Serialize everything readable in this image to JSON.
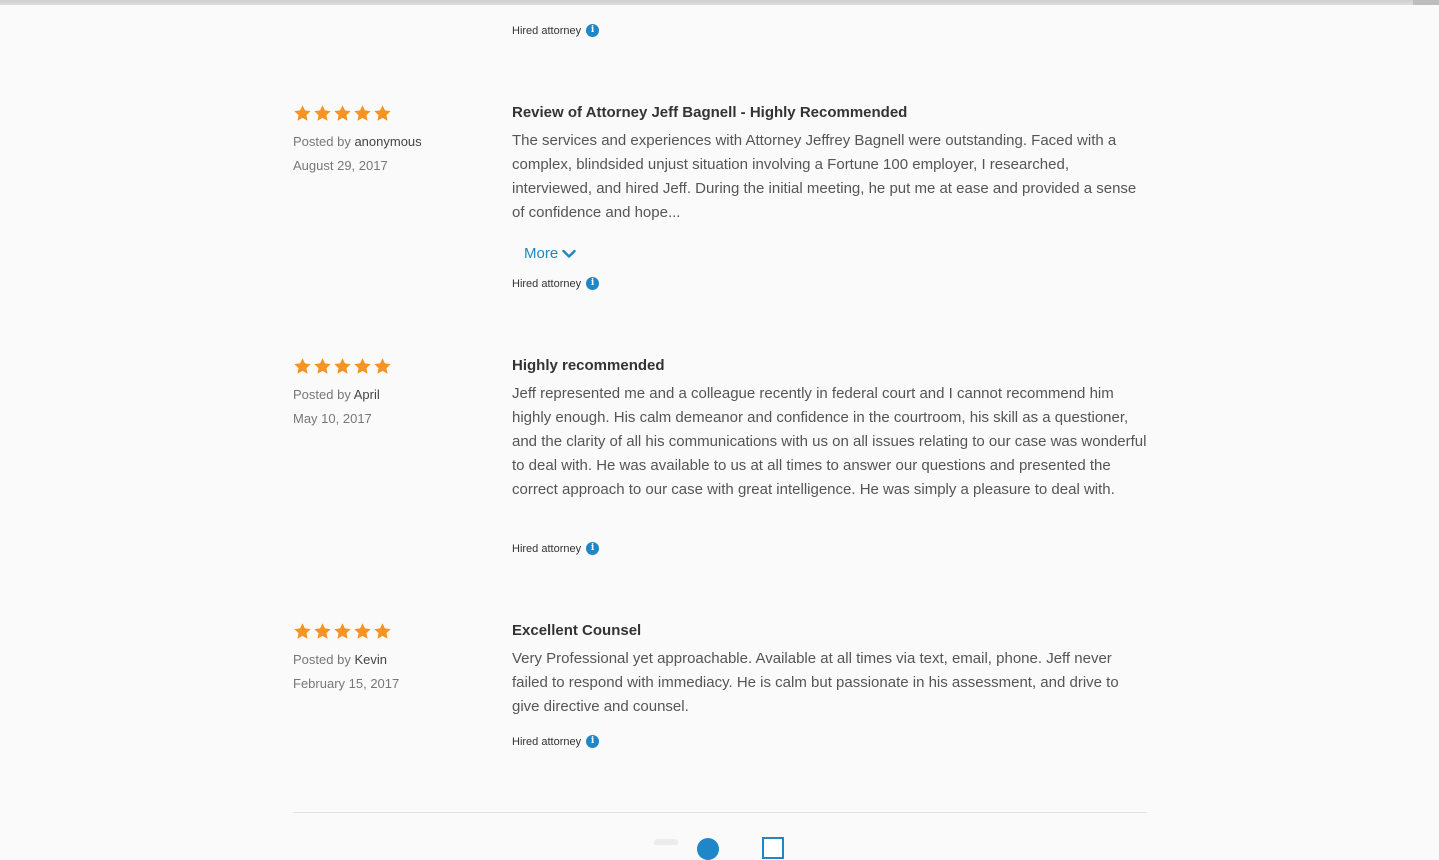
{
  "hired_label": "Hired attorney",
  "info_icon_glyph": "i",
  "posted_by_prefix": "Posted by",
  "more_label": "More",
  "accent_color": "#1f86c7",
  "star_color": "#f79322",
  "reviews": [
    {
      "rating": 5,
      "title": "Review of Attorney Jeff Bagnell - Highly Recommended",
      "author": "anonymous",
      "date": "August 29, 2017",
      "body": "The services and experiences with Attorney Jeffrey Bagnell were outstanding. Faced with a complex, blindsided unjust situation involving a Fortune 100 employer, I researched, interviewed, and hired Jeff. During the initial meeting, he put me at ease and provided a sense of confidence and hope..."
    },
    {
      "rating": 5,
      "title": "Highly recommended",
      "author": "April",
      "date": "May 10, 2017",
      "body": "Jeff represented me and a colleague recently in federal court and I cannot recommend him highly enough. His calm demeanor and confidence in the courtroom, his skill as a questioner, and the clarity of all his communications with us on all issues relating to our case was wonderful to deal with. He was available to us at all times to answer our questions and presented the correct approach to our case with great intelligence. He was simply a pleasure to deal with."
    },
    {
      "rating": 5,
      "title": "Excellent Counsel",
      "author": "Kevin",
      "date": "February 15, 2017",
      "body": "Very Professional yet approachable. Available at all times via text, email, phone. Jeff never failed to respond with immediacy. He is calm but passionate in his assessment, and drive to give directive and counsel."
    }
  ]
}
